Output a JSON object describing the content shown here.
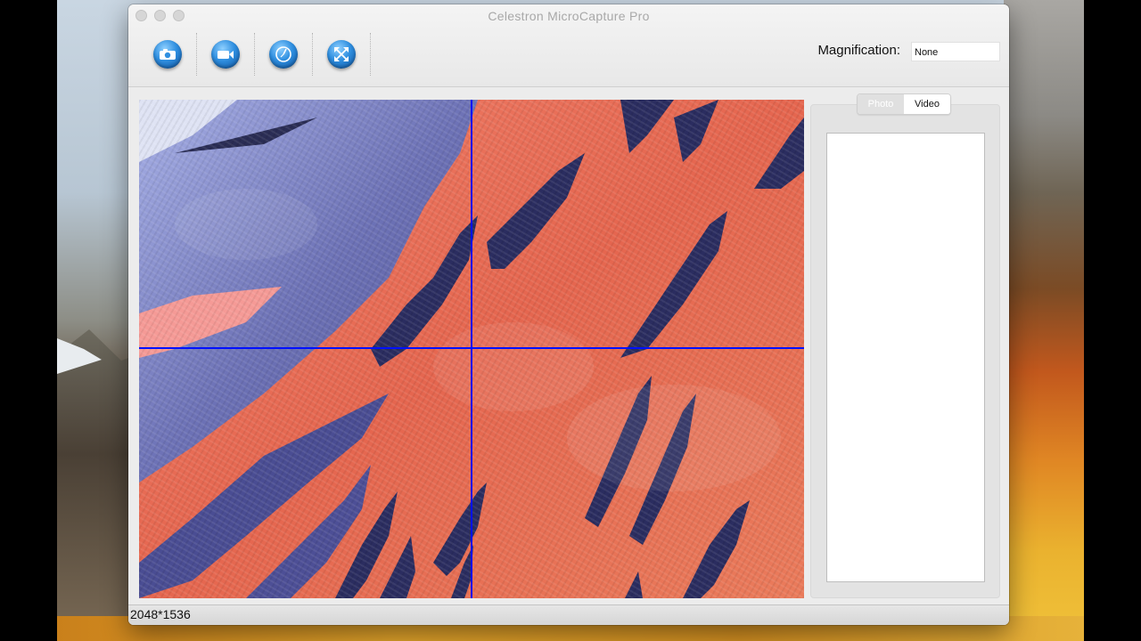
{
  "window": {
    "title": "Celestron MicroCapture Pro"
  },
  "toolbar": {
    "buttons": [
      {
        "icon": "camera-capture-icon"
      },
      {
        "icon": "video-record-icon"
      },
      {
        "icon": "timer-icon"
      },
      {
        "icon": "fullscreen-icon"
      }
    ]
  },
  "magnification": {
    "label": "Magnification:",
    "value": "None"
  },
  "side_panel": {
    "tabs": [
      {
        "label": "Photo",
        "selected": false
      },
      {
        "label": "Video",
        "selected": true
      }
    ]
  },
  "status_bar": {
    "resolution": "2048*1536"
  },
  "colors": {
    "crosshair": "#0010ff",
    "toolbar_icon_accent": "#2f8fe0"
  }
}
